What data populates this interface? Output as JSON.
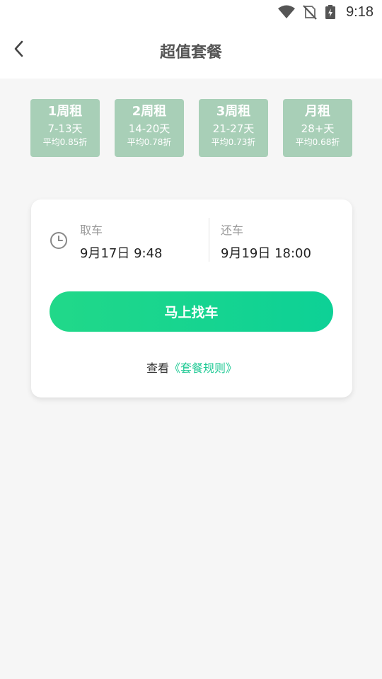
{
  "status_bar": {
    "time": "9:18",
    "icons": [
      "wifi-icon",
      "no-sim-icon",
      "battery-charging-icon"
    ]
  },
  "header": {
    "title": "超值套餐",
    "back_icon": "chevron-left-icon"
  },
  "plans": [
    {
      "name": "1周租",
      "days": "7-13天",
      "discount": "平均0.85折"
    },
    {
      "name": "2周租",
      "days": "14-20天",
      "discount": "平均0.78折"
    },
    {
      "name": "3周租",
      "days": "21-27天",
      "discount": "平均0.73折"
    },
    {
      "name": "月租",
      "days": "28+天",
      "discount": "平均0.68折"
    }
  ],
  "booking": {
    "clock_icon": "clock-icon",
    "pickup": {
      "label": "取车",
      "time": "9月17日 9:48"
    },
    "return": {
      "label": "还车",
      "time": "9月19日 18:00"
    },
    "find_button": "马上找车",
    "rules_prefix": "查看",
    "rules_link": "《套餐规则》"
  },
  "colors": {
    "plan_card": "#a8cfb7",
    "accent_green": "#1fc994",
    "background": "#f6f6f6"
  }
}
